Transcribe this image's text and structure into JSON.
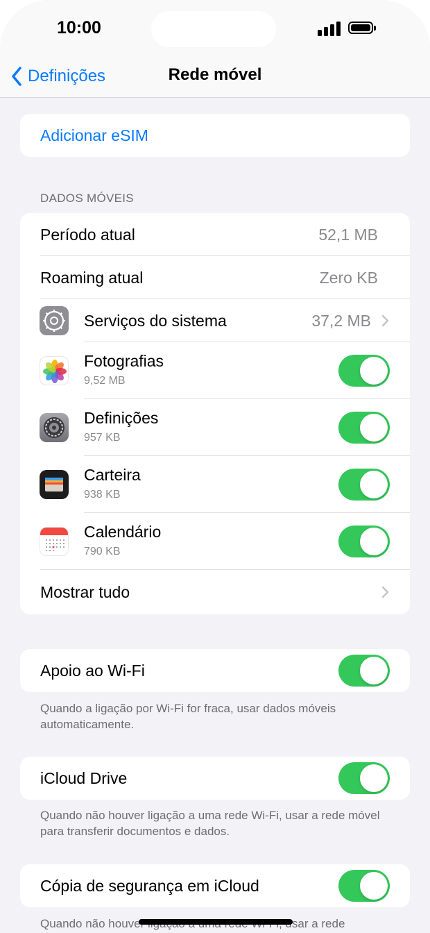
{
  "status": {
    "time": "10:00"
  },
  "nav": {
    "back_label": "Definições",
    "title": "Rede móvel"
  },
  "esim": {
    "label": "Adicionar eSIM"
  },
  "mobile_data": {
    "header": "DADOS MÓVEIS",
    "current_period": {
      "label": "Período atual",
      "value": "52,1 MB"
    },
    "current_roaming": {
      "label": "Roaming atual",
      "value": "Zero KB"
    },
    "system_services": {
      "label": "Serviços do sistema",
      "value": "37,2 MB"
    },
    "apps": [
      {
        "name": "Fotografias",
        "size": "9,52 MB",
        "enabled": true,
        "icon": "photos-icon"
      },
      {
        "name": "Definições",
        "size": "957 KB",
        "enabled": true,
        "icon": "settings-icon"
      },
      {
        "name": "Carteira",
        "size": "938 KB",
        "enabled": true,
        "icon": "wallet-icon"
      },
      {
        "name": "Calendário",
        "size": "790 KB",
        "enabled": true,
        "icon": "calendar-icon"
      }
    ],
    "show_all": "Mostrar tudo"
  },
  "wifi_assist": {
    "label": "Apoio ao Wi-Fi",
    "enabled": true,
    "footer": "Quando a ligação por Wi-Fi for fraca, usar dados móveis automaticamente."
  },
  "icloud_drive": {
    "label": "iCloud Drive",
    "enabled": true,
    "footer": "Quando não houver ligação a uma rede Wi-Fi, usar a rede móvel para transferir documentos e dados."
  },
  "icloud_backup": {
    "label": "Cópia de segurança em iCloud",
    "enabled": true,
    "footer": "Quando não houver ligação a uma rede Wi-Fi, usar a rede"
  },
  "colors": {
    "accent": "#0a7aff",
    "toggle_on": "#34c759",
    "background": "#f2f2f7"
  }
}
